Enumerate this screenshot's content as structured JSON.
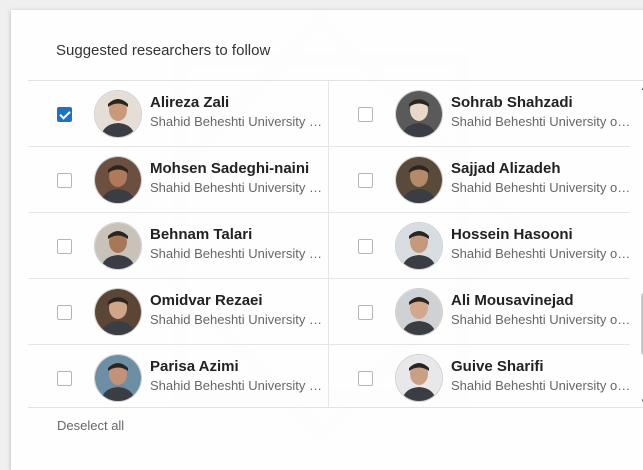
{
  "dialog": {
    "title": "Suggested researchers to follow",
    "deselect_label": "Deselect all"
  },
  "researchers": [
    {
      "name": "Alireza Zali",
      "affiliation": "Shahid Beheshti University of Medical Sciences",
      "selected": true
    },
    {
      "name": "Sohrab Shahzadi",
      "affiliation": "Shahid Beheshti University of Medical Sciences",
      "selected": false
    },
    {
      "name": "Mohsen Sadeghi-naini",
      "affiliation": "Shahid Beheshti University of Medical Sciences",
      "selected": false
    },
    {
      "name": "Sajjad Alizadeh",
      "affiliation": "Shahid Beheshti University of Medical Sciences",
      "selected": false
    },
    {
      "name": "Behnam Talari",
      "affiliation": "Shahid Beheshti University of Medical Sciences",
      "selected": false
    },
    {
      "name": "Hossein Hasooni",
      "affiliation": "Shahid Beheshti University of Medical Sciences",
      "selected": false
    },
    {
      "name": "Omidvar Rezaei",
      "affiliation": "Shahid Beheshti University of Medical Sciences",
      "selected": false
    },
    {
      "name": "Ali Mousavinejad",
      "affiliation": "Shahid Beheshti University of Medical Sciences",
      "selected": false
    },
    {
      "name": "Parisa Azimi",
      "affiliation": "Shahid Beheshti University of Medical Sciences",
      "selected": false
    },
    {
      "name": "Guive Sharifi",
      "affiliation": "Shahid Beheshti University of Medical Sciences",
      "selected": false
    }
  ],
  "colors": {
    "checkbox_checked": "#1a73c7",
    "avatar_backgrounds": [
      "#e4ded6",
      "#5a5a5a",
      "#6b5040",
      "#5a4a3a",
      "#c9c2b8",
      "#d8dde2",
      "#5b4636",
      "#cfd2d4",
      "#6d8fa6",
      "#e8e8ea"
    ],
    "avatar_skin": [
      "#c89a7a",
      "#e8d8c8",
      "#b07a5a",
      "#b58a68",
      "#a77858",
      "#c59a7c",
      "#d0a688",
      "#d2a78a",
      "#c49276",
      "#caa084"
    ]
  }
}
